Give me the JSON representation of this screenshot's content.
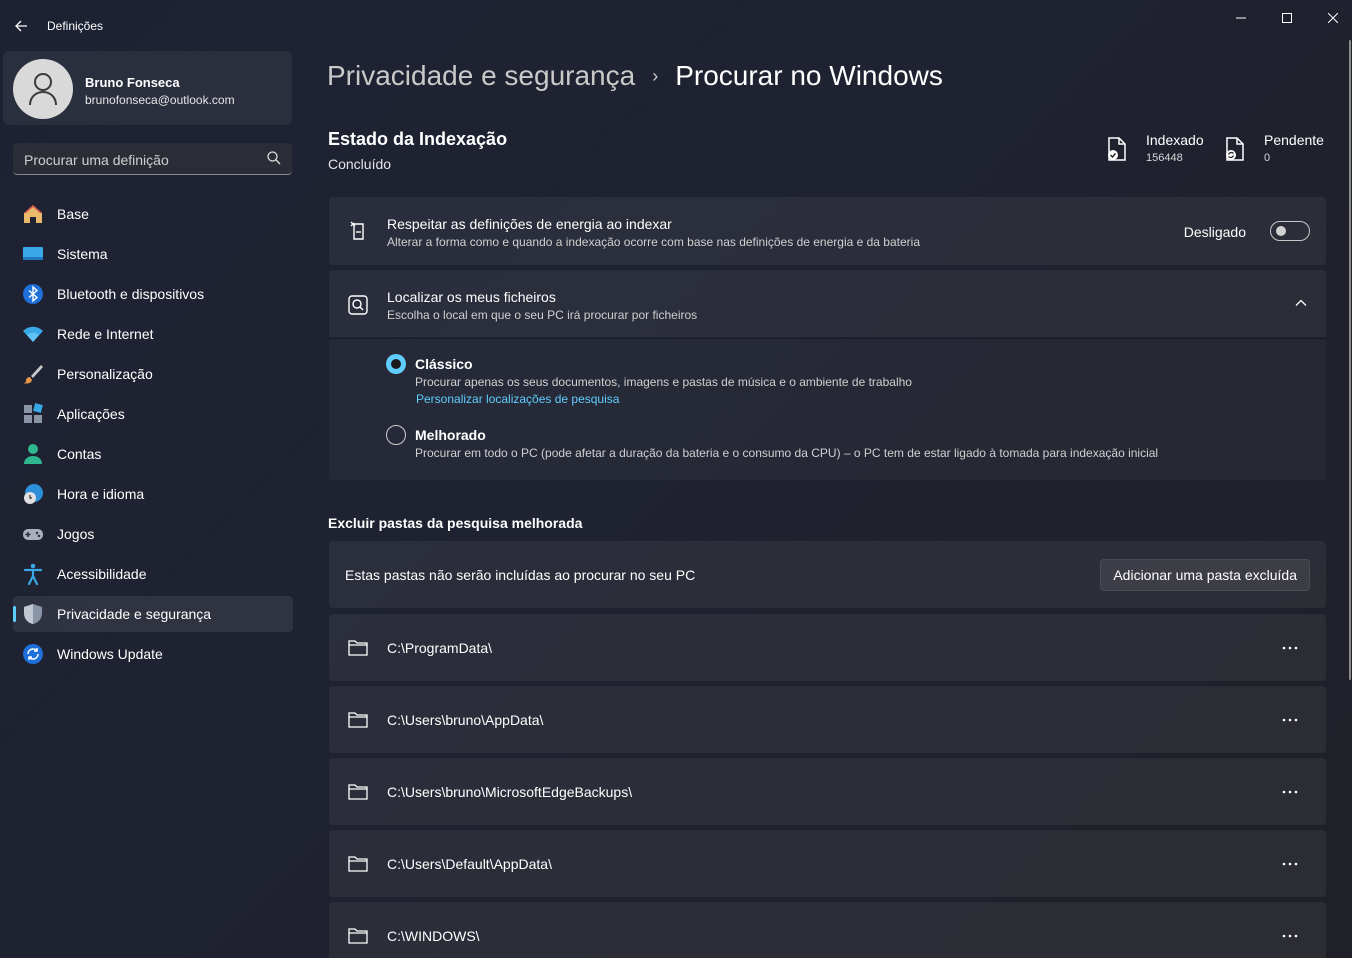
{
  "window": {
    "title": "Definições"
  },
  "profile": {
    "name": "Bruno Fonseca",
    "email": "brunofonseca@outlook.com"
  },
  "search": {
    "placeholder": "Procurar uma definição"
  },
  "nav": [
    {
      "label": "Base",
      "icon": "home-icon"
    },
    {
      "label": "Sistema",
      "icon": "system-icon"
    },
    {
      "label": "Bluetooth e dispositivos",
      "icon": "bluetooth-icon"
    },
    {
      "label": "Rede e Internet",
      "icon": "wifi-icon"
    },
    {
      "label": "Personalização",
      "icon": "brush-icon"
    },
    {
      "label": "Aplicações",
      "icon": "apps-icon"
    },
    {
      "label": "Contas",
      "icon": "account-icon"
    },
    {
      "label": "Hora e idioma",
      "icon": "clock-globe-icon"
    },
    {
      "label": "Jogos",
      "icon": "gamepad-icon"
    },
    {
      "label": "Acessibilidade",
      "icon": "accessibility-icon"
    },
    {
      "label": "Privacidade e segurança",
      "icon": "shield-icon",
      "active": true
    },
    {
      "label": "Windows Update",
      "icon": "update-icon"
    }
  ],
  "breadcrumb": {
    "parent": "Privacidade e segurança",
    "separator": "›",
    "current": "Procurar no Windows"
  },
  "indexing": {
    "title": "Estado da Indexação",
    "status": "Concluído",
    "indexed_label": "Indexado",
    "indexed_value": "156448",
    "pending_label": "Pendente",
    "pending_value": "0"
  },
  "power_setting": {
    "title": "Respeitar as definições de energia ao indexar",
    "subtitle": "Alterar a forma como e quando a indexação ocorre com base nas definições de energia e da bateria",
    "state_label": "Desligado",
    "enabled": false
  },
  "find_files": {
    "title": "Localizar os meus ficheiros",
    "subtitle": "Escolha o local em que o seu PC irá procurar por ficheiros",
    "options": [
      {
        "title": "Clássico",
        "description": "Procurar apenas os seus documentos, imagens e pastas de música e o ambiente de trabalho",
        "link": "Personalizar localizações de pesquisa",
        "selected": true
      },
      {
        "title": "Melhorado",
        "description": "Procurar em todo o PC (pode afetar a duração da bateria e o consumo da CPU) – o PC tem de estar ligado à tomada para indexação inicial",
        "selected": false
      }
    ]
  },
  "exclude": {
    "section_title": "Excluir pastas da pesquisa melhorada",
    "description": "Estas pastas não serão incluídas ao procurar no seu PC",
    "button_label": "Adicionar uma pasta excluída",
    "folders": [
      "C:\\ProgramData\\",
      "C:\\Users\\bruno\\AppData\\",
      "C:\\Users\\bruno\\MicrosoftEdgeBackups\\",
      "C:\\Users\\Default\\AppData\\",
      "C:\\WINDOWS\\"
    ]
  },
  "colors": {
    "accent": "#60cdff",
    "background": "#1f2230",
    "card": "#2a2c35"
  }
}
